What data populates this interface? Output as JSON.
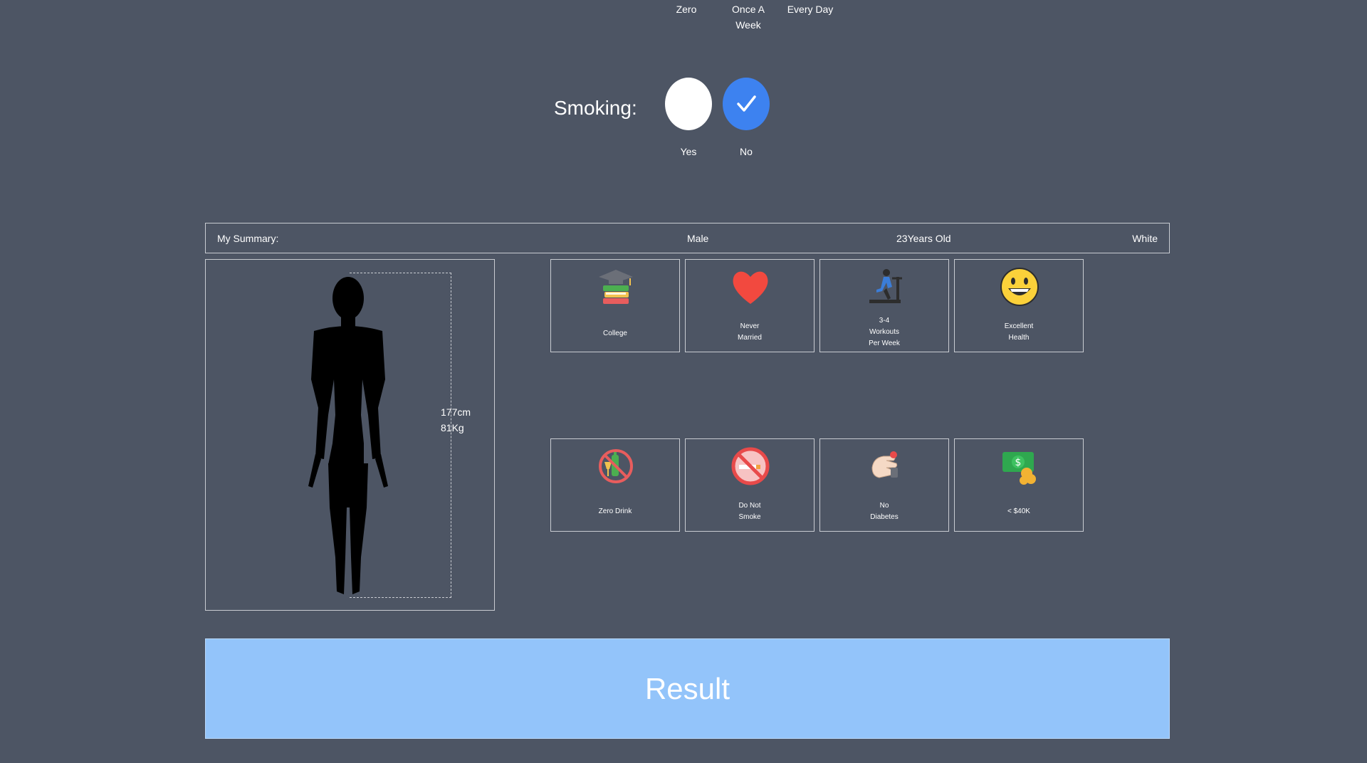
{
  "drinking_options": [
    {
      "label": "Zero"
    },
    {
      "label": "Once A\nWeek"
    },
    {
      "label": "Every Day"
    }
  ],
  "smoking": {
    "label": "Smoking:",
    "options": [
      {
        "label": "Yes",
        "selected": false
      },
      {
        "label": "No",
        "selected": true
      }
    ],
    "accent_color": "#3d82f0"
  },
  "summary": {
    "title": "My Summary:",
    "sex": "Male",
    "age": "23Years Old",
    "race": "White"
  },
  "body": {
    "height": "177cm",
    "weight": "81Kg"
  },
  "cards": [
    {
      "icon": "graduation-books-icon",
      "caption": "College"
    },
    {
      "icon": "heart-icon",
      "caption": "Never\nMarried"
    },
    {
      "icon": "treadmill-runner-icon",
      "caption": "3-4\nWorkouts\nPer Week"
    },
    {
      "icon": "grinning-face-icon",
      "caption": "Excellent\nHealth"
    },
    {
      "icon": "no-alcohol-icon",
      "caption": "Zero Drink"
    },
    {
      "icon": "no-smoking-icon",
      "caption": "Do Not\nSmoke"
    },
    {
      "icon": "diabetes-test-icon",
      "caption": "No\nDiabetes"
    },
    {
      "icon": "money-icon",
      "caption": "< $40K"
    }
  ],
  "result_button": {
    "label": "Result",
    "color": "#93c4fa"
  }
}
